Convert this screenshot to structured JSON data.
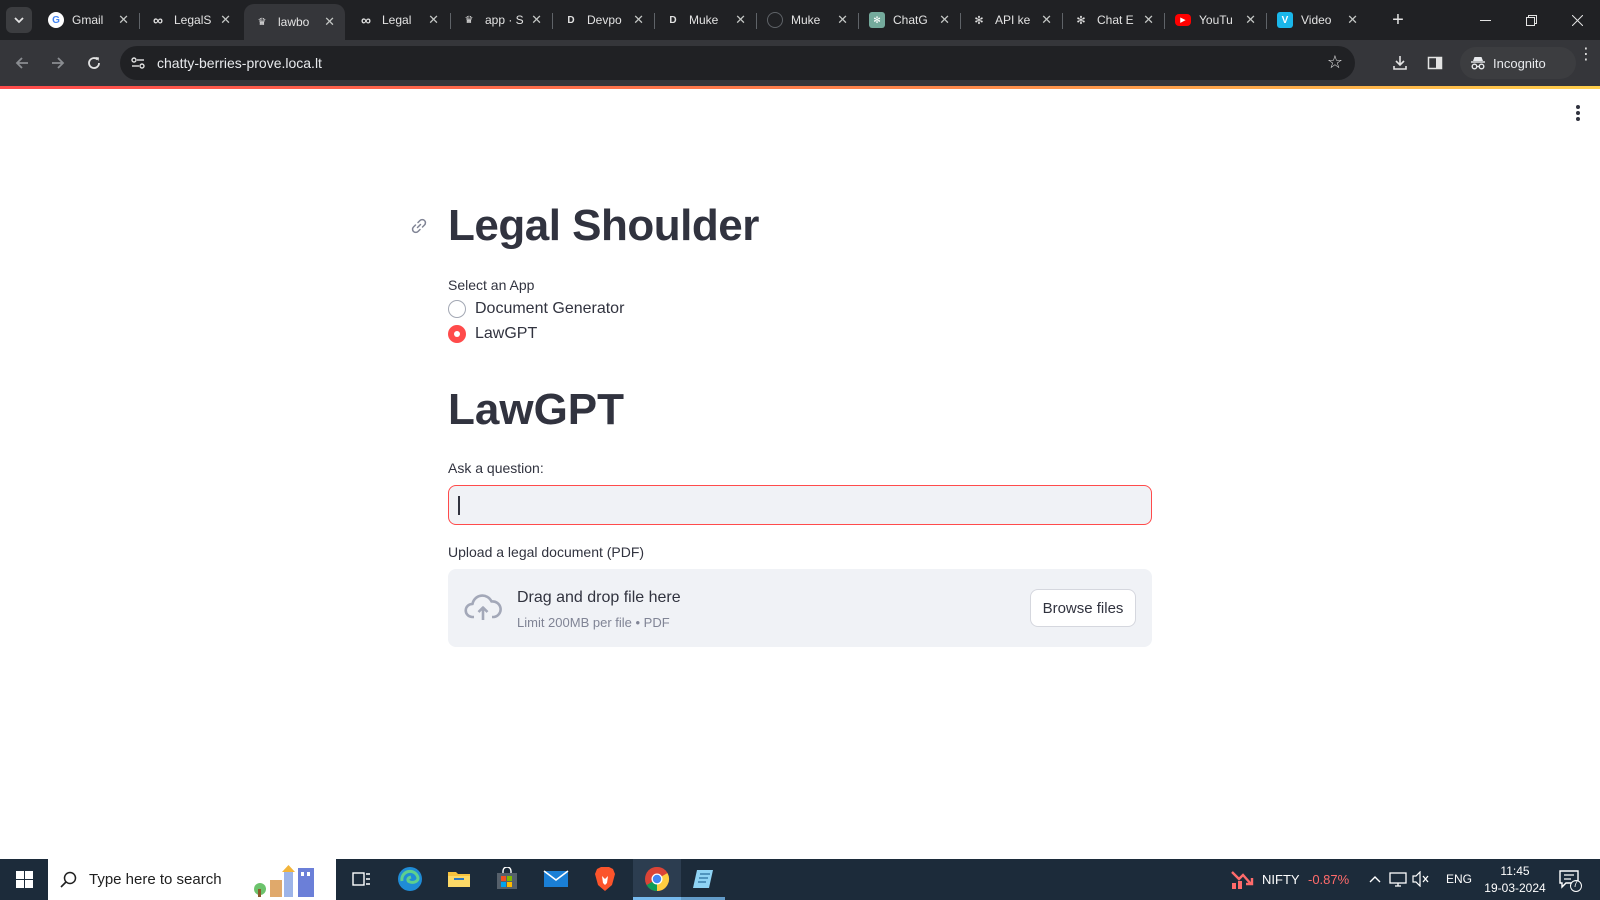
{
  "browser": {
    "tabs": [
      {
        "title": "Gmail",
        "icon": "google-icon",
        "active": false
      },
      {
        "title": "LegalS",
        "icon": "infinity-icon",
        "active": false
      },
      {
        "title": "lawbo",
        "icon": "streamlit-crown-icon",
        "active": true
      },
      {
        "title": "Legal",
        "icon": "infinity-icon",
        "active": false
      },
      {
        "title": "app · S",
        "icon": "streamlit-crown-icon",
        "active": false
      },
      {
        "title": "Devpo",
        "icon": "devpost-icon",
        "active": false
      },
      {
        "title": "Muke",
        "icon": "devpost-icon",
        "active": false
      },
      {
        "title": "Muke",
        "icon": "github-icon",
        "active": false
      },
      {
        "title": "ChatG",
        "icon": "chatgpt-icon",
        "active": false
      },
      {
        "title": "API ke",
        "icon": "openai-icon",
        "active": false
      },
      {
        "title": "Chat E",
        "icon": "openai-icon",
        "active": false
      },
      {
        "title": "YouTu",
        "icon": "youtube-icon",
        "active": false
      },
      {
        "title": "Video",
        "icon": "vimeo-icon",
        "active": false
      }
    ],
    "url": "chatty-berries-prove.loca.lt",
    "incognito_label": "Incognito"
  },
  "app": {
    "title": "Legal Shoulder",
    "select_label": "Select an App",
    "options": [
      "Document Generator",
      "LawGPT"
    ],
    "selected_option": "LawGPT",
    "section_title": "LawGPT",
    "question_label": "Ask a question:",
    "question_value": "",
    "upload_label": "Upload a legal document (PDF)",
    "dropzone_main": "Drag and drop file here",
    "dropzone_sub": "Limit 200MB per file • PDF",
    "browse_label": "Browse files",
    "accent_color": "#ff4b4b"
  },
  "taskbar": {
    "search_placeholder": "Type here to search",
    "nifty_label": "NIFTY",
    "nifty_change": "-0.87%",
    "language": "ENG",
    "time": "11:45",
    "date": "19-03-2024",
    "notification_count": "7"
  }
}
